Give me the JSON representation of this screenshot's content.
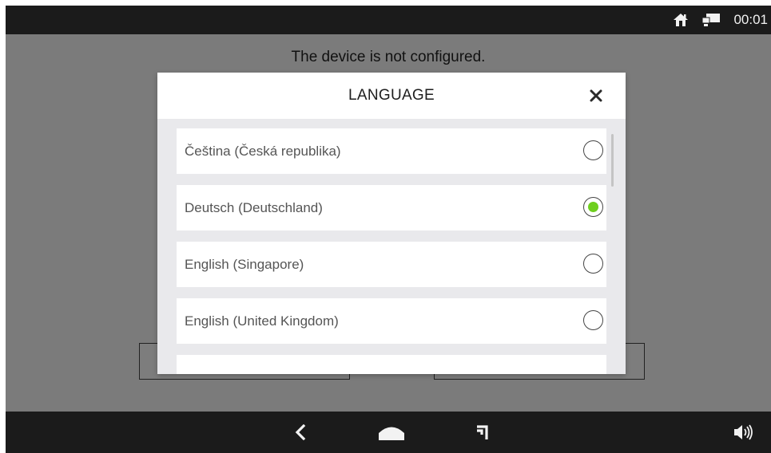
{
  "status_bar": {
    "time": "00:01",
    "icons": [
      "home-network-icon",
      "monitor-icon"
    ]
  },
  "main": {
    "banner_text": "The device is not configured."
  },
  "dialog": {
    "title": "LANGUAGE",
    "close_icon": "close-icon",
    "items": [
      {
        "label": "Čeština (Česká republika)",
        "selected": false
      },
      {
        "label": "Deutsch (Deutschland)",
        "selected": true
      },
      {
        "label": "English (Singapore)",
        "selected": false
      },
      {
        "label": "English (United Kingdom)",
        "selected": false
      },
      {
        "label": "",
        "selected": false
      }
    ],
    "selected_color": "#6fcf1f"
  },
  "nav_bar": {
    "icons": [
      "back-icon",
      "home-icon",
      "recent-apps-icon",
      "volume-icon"
    ]
  }
}
